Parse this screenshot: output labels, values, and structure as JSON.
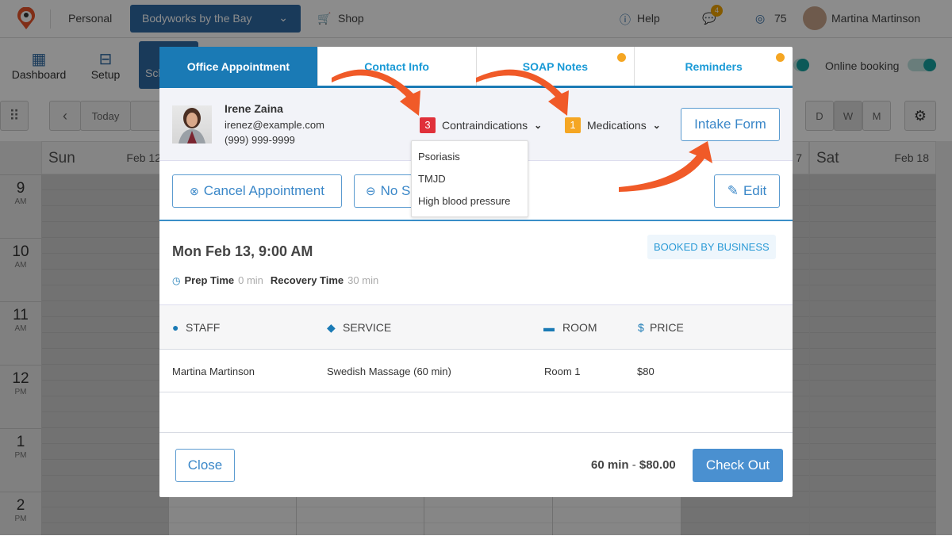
{
  "topbar": {
    "personal": "Personal",
    "business": "Bodyworks by the Bay",
    "shop": "Shop",
    "help": "Help",
    "notifications_count": "4",
    "points": "75",
    "user_name": "Martina Martinson"
  },
  "nav": {
    "dashboard": "Dashboard",
    "setup": "Setup",
    "schedule": "Sch"
  },
  "toolbar": {
    "today": "Today",
    "views": [
      "D",
      "W",
      "M"
    ],
    "active_view": "W",
    "online_booking": "Online booking"
  },
  "calendar": {
    "days": [
      {
        "name": "Sun",
        "date": "Feb 12"
      },
      {
        "name": "Sat",
        "date": "Feb 18"
      }
    ],
    "partial_date": "7",
    "hours": [
      {
        "n": "9",
        "m": "AM"
      },
      {
        "n": "10",
        "m": "AM"
      },
      {
        "n": "11",
        "m": "AM"
      },
      {
        "n": "12",
        "m": "PM"
      },
      {
        "n": "1",
        "m": "PM"
      },
      {
        "n": "2",
        "m": "PM"
      }
    ]
  },
  "modal": {
    "tabs": [
      {
        "label": "Office Appointment",
        "active": true
      },
      {
        "label": "Contact Info"
      },
      {
        "label": "SOAP Notes",
        "dot": true
      },
      {
        "label": "Reminders",
        "dot": true
      }
    ],
    "client": {
      "name": "Irene Zaina",
      "email": "irenez@example.com",
      "phone": "(999) 999-9999"
    },
    "contraindications": {
      "count": "3",
      "label": "Contraindications",
      "color": "#e0303a",
      "items": [
        "Psoriasis",
        "TMJD",
        "High blood pressure"
      ]
    },
    "medications": {
      "count": "1",
      "label": "Medications",
      "color": "#f5a623"
    },
    "intake_form": "Intake Form",
    "actions": {
      "cancel": "Cancel Appointment",
      "no_show": "No Show",
      "edit": "Edit"
    },
    "datetime": "Mon Feb 13, 9:00 AM",
    "booked_by": "BOOKED BY BUSINESS",
    "prep_label": "Prep Time",
    "prep_value": "0 min",
    "recovery_label": "Recovery Time",
    "recovery_value": "30 min",
    "table": {
      "headers": [
        "STAFF",
        "SERVICE",
        "ROOM",
        "PRICE"
      ],
      "row": [
        "Martina Martinson",
        "Swedish Massage (60 min)",
        "Room 1",
        "$80"
      ]
    },
    "footer": {
      "close": "Close",
      "summary_duration": "60 min",
      "summary_price": "$80.00",
      "checkout": "Check Out"
    }
  },
  "colors": {
    "accent": "#1a7ab5",
    "annotation_arrow": "#f05a28"
  }
}
